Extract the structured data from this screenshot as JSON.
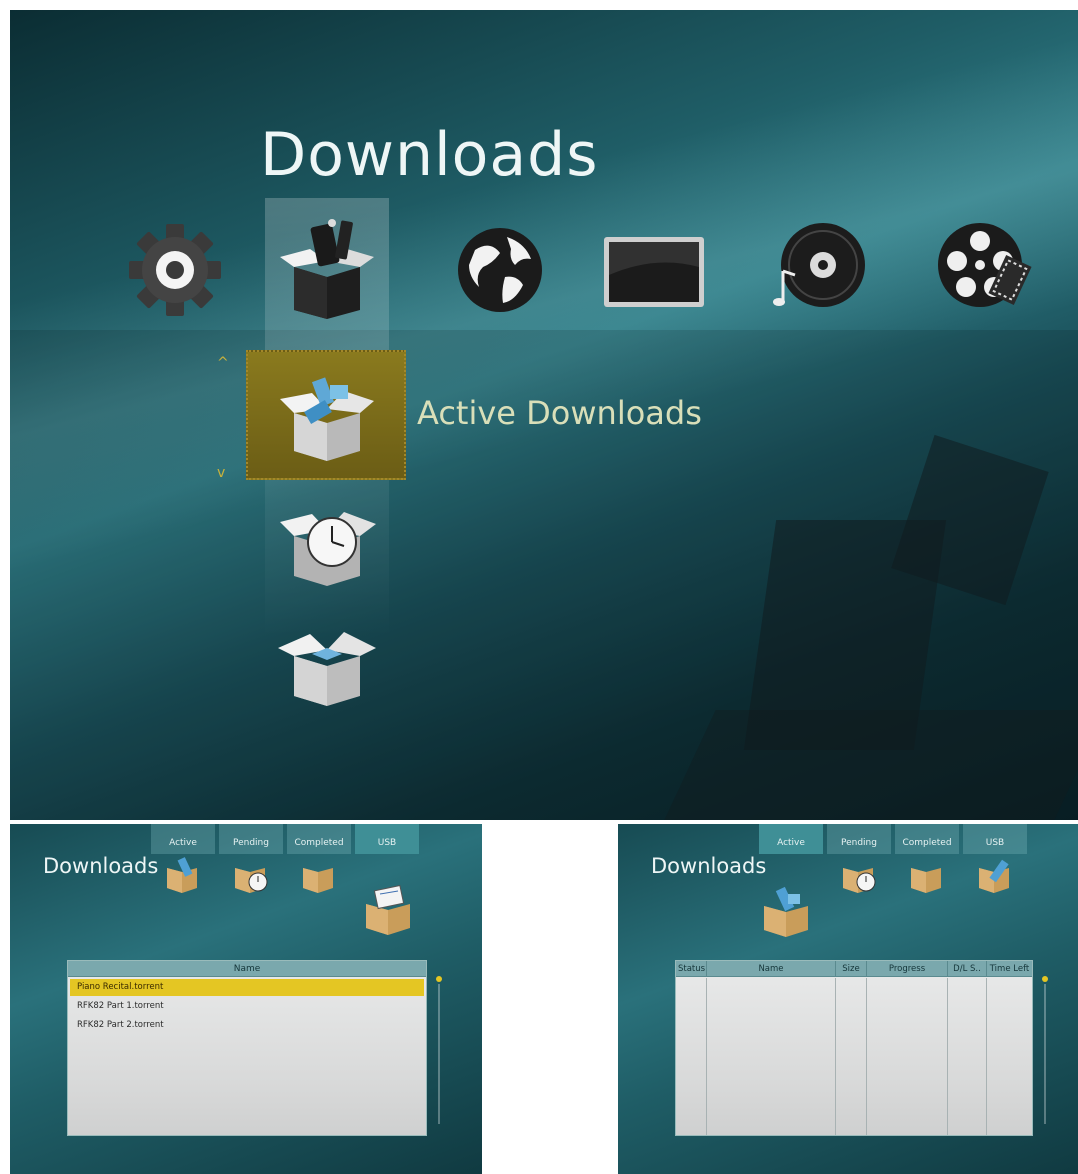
{
  "main": {
    "title": "Downloads",
    "categories": [
      "settings-gear",
      "downloads-box",
      "internet-globe",
      "tv-screen",
      "music-disc",
      "video-reel"
    ],
    "selected_item_label": "Active Downloads",
    "menu_items": [
      "active-downloads",
      "pending-downloads",
      "completed-downloads"
    ]
  },
  "usb_panel": {
    "title": "Downloads",
    "tabs": [
      "Active",
      "Pending",
      "Completed",
      "USB"
    ],
    "selected_tab": "USB",
    "list_header": "Name",
    "files": [
      "Piano Recital.torrent",
      "RFK82 Part 1.torrent",
      "RFK82 Part 2.torrent"
    ],
    "selected_file": "Piano Recital.torrent"
  },
  "active_panel": {
    "title": "Downloads",
    "tabs": [
      "Active",
      "Pending",
      "Completed",
      "USB"
    ],
    "selected_tab": "Active",
    "columns": [
      "Status",
      "Name",
      "Size",
      "Progress",
      "D/L S..",
      "Time Left"
    ]
  },
  "colors": {
    "accent_yellow": "#e4c623",
    "teal": "#2a717b",
    "selection_gold": "#8a7a1e"
  }
}
